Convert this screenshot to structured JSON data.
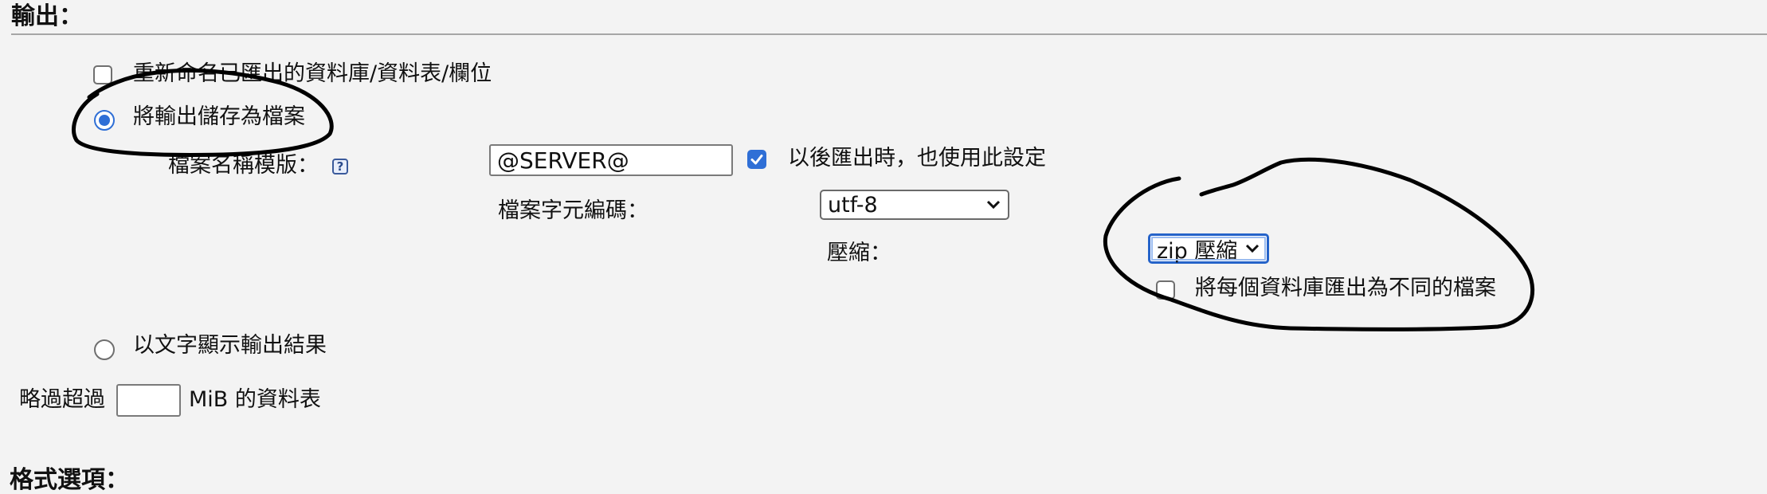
{
  "output_section": {
    "heading": "輸出：",
    "rename_label": "重新命名已匯出的資料庫/資料表/欄位",
    "save_to_file_label": "將輸出儲存為檔案",
    "filename_template_label": "檔案名稱模版：",
    "filename_template_value": "@SERVER@",
    "remember_template_label": "以後匯出時，也使用此設定",
    "charset_label": "檔案字元編碼：",
    "charset_selected": "utf-8",
    "compression_label": "壓縮：",
    "compression_selected": "zip 壓縮",
    "separate_files_label": "將每個資料庫匯出為不同的檔案",
    "view_as_text_label": "以文字顯示輸出結果",
    "skip_tables_prefix": "略過超過",
    "skip_tables_value": "",
    "skip_tables_suffix": "MiB 的資料表"
  },
  "format_section": {
    "heading": "格式選項："
  },
  "state": {
    "rename_checked": false,
    "save_to_file_selected": true,
    "remember_template_checked": true,
    "separate_files_checked": false,
    "view_as_text_selected": false
  },
  "icons": {
    "help": "help-icon",
    "check": "check-icon",
    "dropdown": "chevron-down-icon"
  },
  "colors": {
    "accent": "#2f6fd6",
    "focus": "#2563c9",
    "background": "#f3f3f3",
    "annotation_ink": "#000000"
  }
}
